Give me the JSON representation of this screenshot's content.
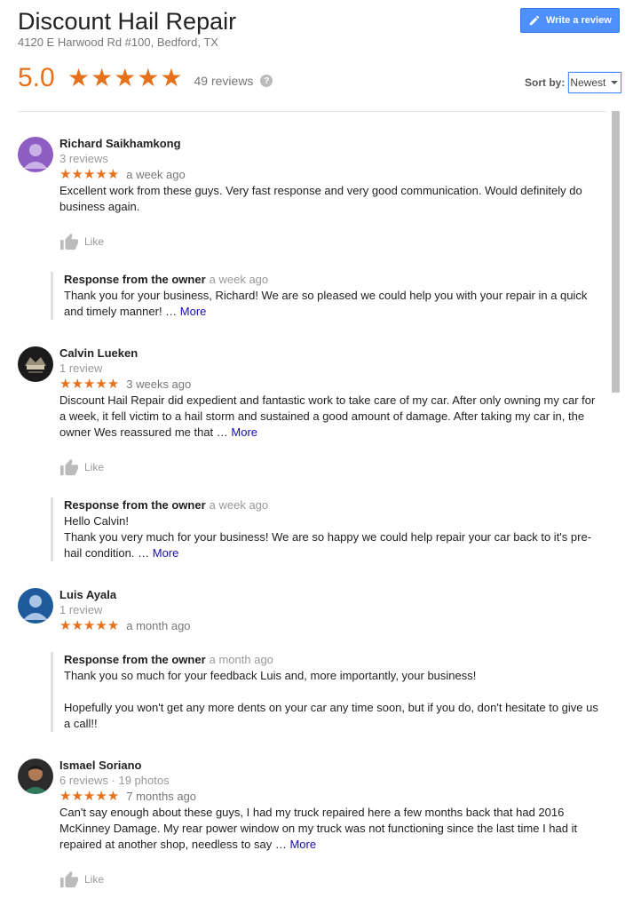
{
  "business": {
    "name": "Discount Hail Repair",
    "address": "4120 E Harwood Rd #100, Bedford, TX",
    "rating": "5.0",
    "stars": "★★★★★",
    "review_count": "49 reviews",
    "help_symbol": "?"
  },
  "actions": {
    "write_review": "Write a review"
  },
  "sort": {
    "label": "Sort by:",
    "selected": "Newest"
  },
  "colors": {
    "accent": "#e7711b",
    "button": "#4d90fe",
    "link": "#1a0dab"
  },
  "reviews": [
    {
      "name": "Richard Saikhamkong",
      "meta": "3 reviews",
      "stars": "★★★★★",
      "time": "a week ago",
      "text": "Excellent work from these guys. Very fast response and very good communication. Would definitely do business again.",
      "like": "Like",
      "response": {
        "title": "Response from the owner",
        "time": "a week ago",
        "text": "Thank you for your business, Richard! We are so pleased we could help you with your repair in a quick and timely manner!",
        "ellipsis": " … ",
        "more": "More"
      }
    },
    {
      "name": "Calvin Lueken",
      "meta": "1 review",
      "stars": "★★★★★",
      "time": "3 weeks ago",
      "text": "Discount Hail Repair did expedient and fantastic work to take care of my car. After only owning my car for a week, it fell victim to a hail storm and sustained a good amount of damage. After taking my car in, the owner Wes reassured me that",
      "ellipsis": " … ",
      "more": "More",
      "like": "Like",
      "response": {
        "title": "Response from the owner",
        "time": "a week ago",
        "line1": "Hello Calvin!",
        "text": "Thank you very much for your business! We are so happy we could help repair your car back to it's pre-hail condition.",
        "ellipsis": " … ",
        "more": "More"
      }
    },
    {
      "name": "Luis Ayala",
      "meta": "1 review",
      "stars": "★★★★★",
      "time": "a month ago",
      "response": {
        "title": "Response from the owner",
        "time": "a month ago",
        "line1": "Thank you so much for your feedback Luis and, more importantly, your business!",
        "text": "Hopefully you won't get any more dents on your car any time soon, but if you do, don't hesitate to give us a call!!"
      }
    },
    {
      "name": "Ismael Soriano",
      "meta": "6 reviews · 19 photos",
      "stars": "★★★★★",
      "time": "7 months ago",
      "text": "Can't say enough about these guys, I had my truck repaired here a few months back that had 2016 McKinney Damage. My rear power window on my truck was not functioning since the last time I had it repaired at another shop, needless to say",
      "ellipsis": " … ",
      "more": "More",
      "like": "Like"
    }
  ]
}
